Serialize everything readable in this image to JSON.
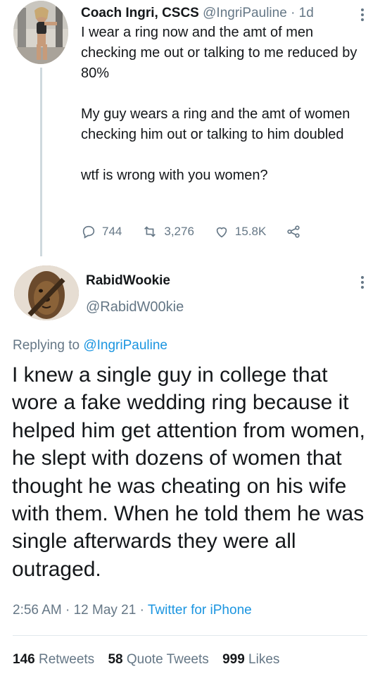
{
  "parent_tweet": {
    "author_name": "Coach Ingri, CSCS",
    "author_handle": "@IngriPauline",
    "age": "· 1d",
    "text": "I wear a ring now and the amt of men checking me out or talking to me reduced by 80%\n\nMy guy wears a ring and the amt of women checking him out or talking to him doubled\n\nwtf is wrong with you women?",
    "replies": "744",
    "retweets": "3,276",
    "likes": "15.8K"
  },
  "reply_tweet": {
    "author_name": "RabidWookie",
    "author_handle": "@RabidW00kie",
    "replying_prefix": "Replying to",
    "replying_to": "@IngriPauline",
    "text": "I knew a single guy in college that wore a fake wedding ring because it helped him get attention from women, he slept with dozens of women that thought he was cheating on his wife with them. When he told them he was single afterwards they were all outraged.",
    "timestamp": "2:56 AM · 12 May 21 ·",
    "source": "Twitter for iPhone",
    "retweet_count": "146",
    "retweet_label": "Retweets",
    "quote_count": "58",
    "quote_label": "Quote Tweets",
    "like_count": "999",
    "like_label": "Likes"
  },
  "icons": [
    "reply-icon",
    "retweet-icon",
    "like-icon",
    "share-icon",
    "more-icon"
  ],
  "colors": {
    "link": "#1b95e0",
    "secondary": "#657786",
    "primary": "#14171a",
    "divider": "#e1e8ed"
  }
}
